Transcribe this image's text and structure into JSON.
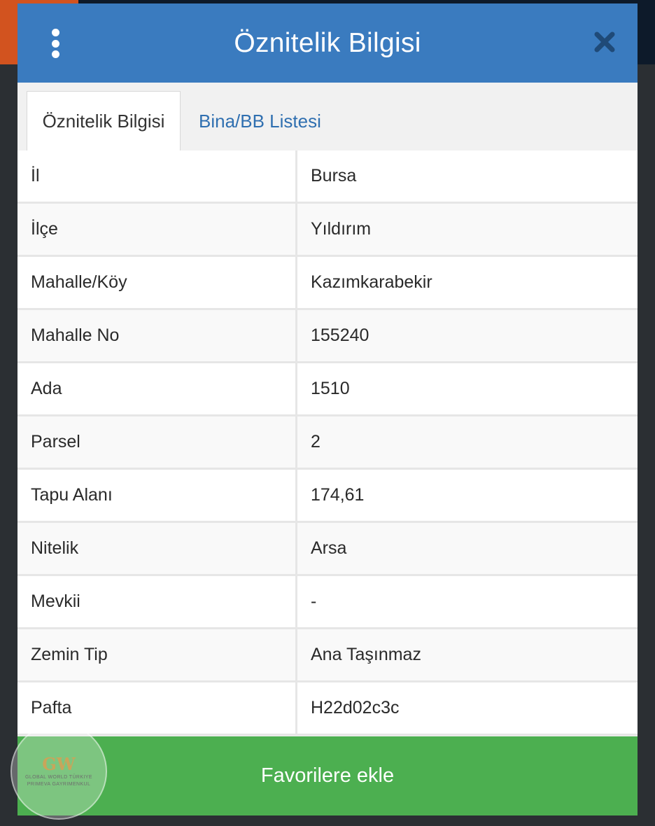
{
  "header": {
    "title": "Öznitelik Bilgisi"
  },
  "tabs": [
    {
      "label": "Öznitelik Bilgisi",
      "active": true
    },
    {
      "label": "Bina/BB Listesi",
      "active": false
    }
  ],
  "rows": [
    {
      "key": "İl",
      "value": "Bursa"
    },
    {
      "key": "İlçe",
      "value": "Yıldırım"
    },
    {
      "key": "Mahalle/Köy",
      "value": "Kazımkarabekir"
    },
    {
      "key": "Mahalle No",
      "value": "155240"
    },
    {
      "key": "Ada",
      "value": "1510"
    },
    {
      "key": "Parsel",
      "value": "2"
    },
    {
      "key": "Tapu Alanı",
      "value": "174,61"
    },
    {
      "key": "Nitelik",
      "value": "Arsa"
    },
    {
      "key": "Mevkii",
      "value": "-"
    },
    {
      "key": "Zemin Tip",
      "value": "Ana Taşınmaz"
    },
    {
      "key": "Pafta",
      "value": "H22d02c3c"
    }
  ],
  "footer": {
    "button_label": "Favorilere ekle"
  },
  "watermark": {
    "logo": "GW",
    "line1": "GLOBAL WORLD TÜRKIYE",
    "line2": "PRIMEVA GAYRIMENKUL"
  },
  "colors": {
    "header": "#3a7bbf",
    "tab_link": "#2f6fb0",
    "favorite_button": "#4caf50"
  },
  "icons": {
    "menu": "vertical-dots-icon",
    "close": "close-icon"
  }
}
